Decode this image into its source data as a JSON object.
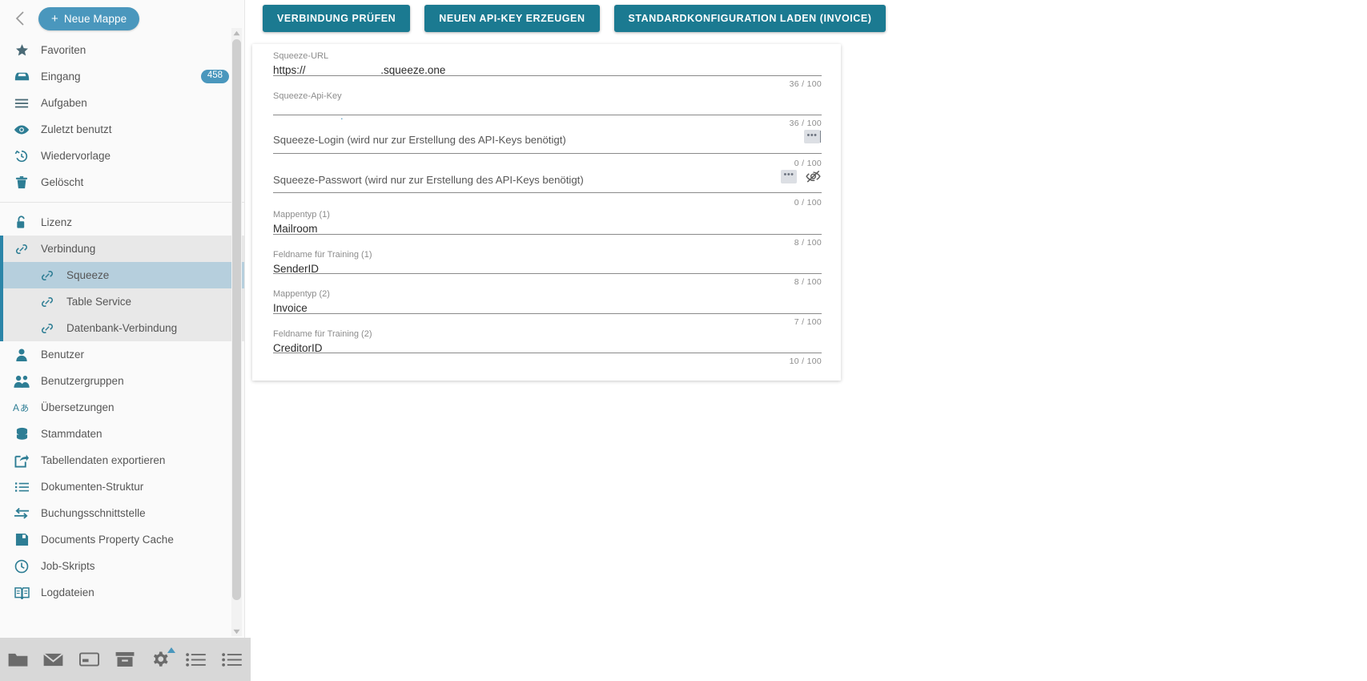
{
  "sidebar": {
    "collapse_icon": "chevron-left-icon",
    "new_folder_label": "Neue Mappe",
    "new_folder_plus": "+",
    "items": [
      {
        "label": "Favoriten",
        "icon": "star-icon"
      },
      {
        "label": "Eingang",
        "icon": "inbox-icon",
        "badge": "458"
      },
      {
        "label": "Aufgaben",
        "icon": "tasks-icon"
      },
      {
        "label": "Zuletzt benutzt",
        "icon": "eye-icon"
      },
      {
        "label": "Wiedervorlage",
        "icon": "history-clock-icon"
      },
      {
        "label": "Gelöscht",
        "icon": "trash-icon"
      }
    ],
    "items2": [
      {
        "label": "Lizenz",
        "icon": "unlock-icon"
      },
      {
        "label": "Verbindung",
        "icon": "link-icon"
      }
    ],
    "subitems": [
      {
        "label": "Squeeze",
        "icon": "link-icon",
        "active": true
      },
      {
        "label": "Table Service",
        "icon": "link-icon",
        "active": false
      },
      {
        "label": "Datenbank-Verbindung",
        "icon": "link-icon",
        "active": false
      }
    ],
    "items3": [
      {
        "label": "Benutzer",
        "icon": "user-icon"
      },
      {
        "label": "Benutzergruppen",
        "icon": "users-icon"
      },
      {
        "label": "Übersetzungen",
        "icon": "translate-icon"
      },
      {
        "label": "Stammdaten",
        "icon": "database-icon"
      },
      {
        "label": "Tabellendaten exportieren",
        "icon": "export-icon"
      },
      {
        "label": "Dokumenten-Struktur",
        "icon": "list-icon"
      },
      {
        "label": "Buchungsschnittstelle",
        "icon": "exchange-arrows-icon"
      },
      {
        "label": "Documents Property Cache",
        "icon": "save-icon"
      },
      {
        "label": "Job-Skripts",
        "icon": "clock-icon"
      },
      {
        "label": "Logdateien",
        "icon": "book-icon"
      }
    ]
  },
  "bottombar": {
    "items": [
      {
        "icon": "folder-icon"
      },
      {
        "icon": "mail-icon"
      },
      {
        "icon": "card-icon"
      },
      {
        "icon": "archive-icon"
      },
      {
        "icon": "gear-icon",
        "caret": true
      },
      {
        "icon": "list-bullets-icon"
      },
      {
        "icon": "list-bullets-icon"
      }
    ]
  },
  "toolbar": {
    "check_connection_label": "VERBINDUNG PRÜFEN",
    "new_api_key_label": "NEUEN API-KEY ERZEUGEN",
    "load_default_config_label": "STANDARDKONFIGURATION LADEN (INVOICE)"
  },
  "form": {
    "fields": [
      {
        "label": "Squeeze-URL",
        "value": "https://                         .squeeze.one",
        "counter": "36 / 100"
      },
      {
        "label": "Squeeze-Api-Key",
        "value": "",
        "counter": "36 / 100"
      },
      {
        "label": "Squeeze-Login (wird nur zur Erstellung des API-Keys benötigt)",
        "value": "",
        "counter": "0 / 100"
      },
      {
        "label": "Squeeze-Passwort (wird nur zur Erstellung des API-Keys benötigt)",
        "value": "",
        "counter": "0 / 100"
      },
      {
        "label": "Mappentyp (1)",
        "value": "Mailroom",
        "counter": "8 / 100"
      },
      {
        "label": "Feldname für Training (1)",
        "value": "SenderID",
        "counter": "8 / 100"
      },
      {
        "label": "Mappentyp (2)",
        "value": "Invoice",
        "counter": "7 / 100"
      },
      {
        "label": "Feldname für Training (2)",
        "value": "CreditorID",
        "counter": "10 / 100"
      }
    ],
    "mask_dots": "•••",
    "password_toggle_icon": "eye-off-icon"
  },
  "colors": {
    "accent_teal": "#1b7a91",
    "accent_blue": "#4a97bd",
    "sidebar_bg": "#fafafa",
    "active_sub_bg": "#b6cfdd",
    "group_bg": "#e8e8e8",
    "bottombar_bg": "#d8d8d8"
  }
}
